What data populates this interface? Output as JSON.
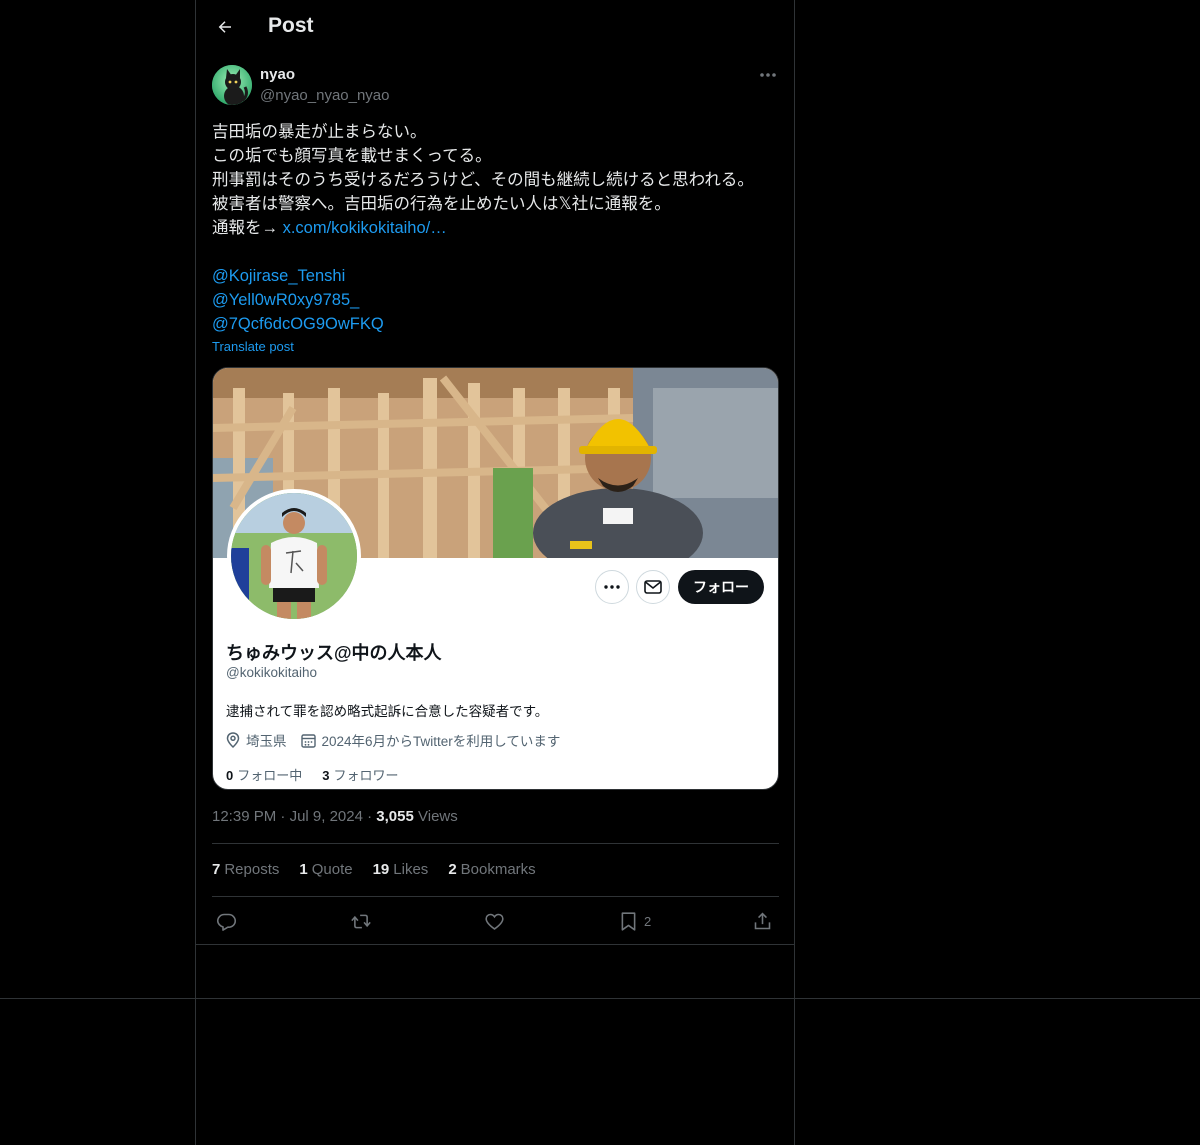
{
  "header": {
    "title": "Post",
    "back_icon": "arrow-left-icon"
  },
  "author": {
    "display_name": "nyao",
    "handle": "@nyao_nyao_nyao",
    "avatar_icon": "black-cat-avatar"
  },
  "post": {
    "lines": [
      "吉田垢の暴走が止まらない。",
      "この垢でも顔写真を載せまくってる。",
      "刑事罰はそのうち受けるだろうけど、その間も継続し続けると思われる。",
      "被害者は警察へ。吉田垢の行為を止めたい人は𝕏社に通報を。"
    ],
    "report_prefix": "通報を→ ",
    "report_link": "x.com/kokikokitaiho/…",
    "mentions": [
      "@Kojirase_Tenshi",
      "@Yell0wR0xy9785_",
      "@7Qcf6dcOG9OwFKQ"
    ],
    "translate_label": "Translate post"
  },
  "embedded_profile": {
    "name": "ちゅみウッス@中の人本人",
    "handle": "@kokikokitaiho",
    "bio": "逮捕されて罪を認め略式起訴に合意した容疑者です。",
    "location": "埼玉県",
    "joined": "2024年6月からTwitterを利用しています",
    "following_count": "0",
    "following_label": "フォロー中",
    "followers_count": "3",
    "followers_label": "フォロワー",
    "follow_button": "フォロー"
  },
  "meta": {
    "time": "12:39 PM",
    "dot1": "·",
    "date": "Jul 9, 2024",
    "dot2": "·",
    "views_count": "3,055",
    "views_label": "Views"
  },
  "stats": {
    "reposts_count": "7",
    "reposts_label": "Reposts",
    "quotes_count": "1",
    "quotes_label": "Quote",
    "likes_count": "19",
    "likes_label": "Likes",
    "bookmarks_count": "2",
    "bookmarks_label": "Bookmarks"
  },
  "actions": {
    "bookmark_count": "2"
  },
  "colors": {
    "background": "#000000",
    "text": "#e7e9ea",
    "muted": "#71767b",
    "link": "#1d9bf0",
    "border": "#2f3336"
  }
}
